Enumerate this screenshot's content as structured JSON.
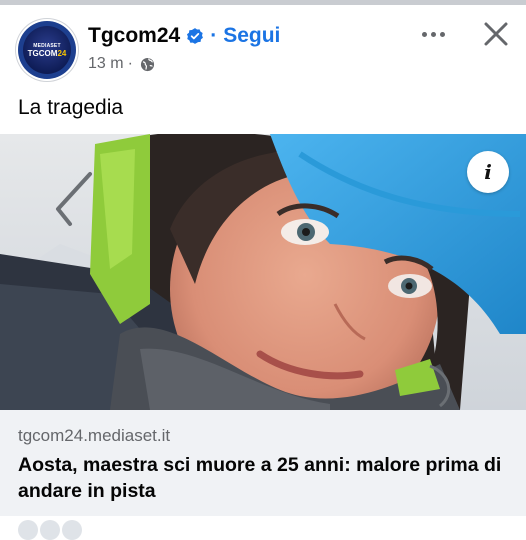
{
  "post": {
    "author": "Tgcom24",
    "follow_label": "Segui",
    "separator": "·",
    "time": "13 m",
    "time_separator": "·",
    "text": "La tragedia",
    "avatar_top": "MEDIASET",
    "avatar_main_1": "TG",
    "avatar_main_2": "COM",
    "avatar_main_3": "24",
    "info_glyph": "i"
  },
  "link": {
    "domain": "tgcom24.mediaset.it",
    "headline": "Aosta, maestra sci muore a 25 anni: malore prima di andare in pista"
  },
  "icons": {
    "verified": "verified-badge-icon",
    "globe": "globe-icon",
    "more": "more-options-icon",
    "close": "close-icon",
    "info": "info-icon"
  },
  "colors": {
    "link_blue": "#1b74e4",
    "secondary_text": "#65676b",
    "card_background": "#f0f2f5"
  }
}
